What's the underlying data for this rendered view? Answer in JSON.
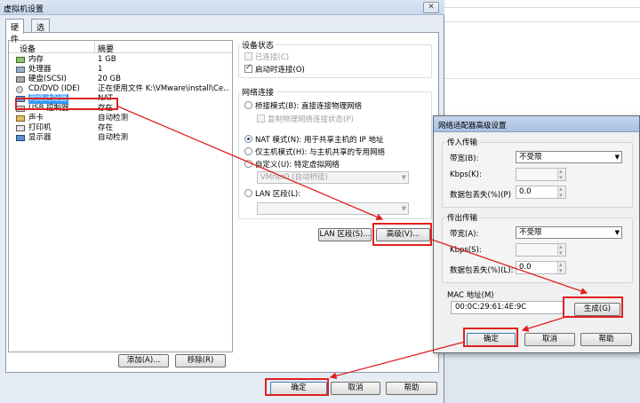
{
  "main_dialog": {
    "title": "虚拟机设置",
    "close": "✕",
    "tabs": [
      "硬件",
      "选项"
    ],
    "device_headers": {
      "device": "设备",
      "summary": "摘要"
    },
    "devices": [
      {
        "name": "内存",
        "summary": "1 GB",
        "icon": "memory-icon"
      },
      {
        "name": "处理器",
        "summary": "1",
        "icon": "cpu-icon"
      },
      {
        "name": "硬盘(SCSI)",
        "summary": "20 GB",
        "icon": "harddisk-icon"
      },
      {
        "name": "CD/DVD (IDE)",
        "summary": "正在使用文件 K:\\VMware\\install\\Ce...",
        "icon": "cdrom-icon"
      },
      {
        "name": "网络适配器",
        "summary": "NAT",
        "icon": "network-adapter-icon"
      },
      {
        "name": "USB 控制器",
        "summary": "存在",
        "icon": "usb-icon"
      },
      {
        "name": "声卡",
        "summary": "自动检测",
        "icon": "sound-icon"
      },
      {
        "name": "打印机",
        "summary": "存在",
        "icon": "printer-icon"
      },
      {
        "name": "显示器",
        "summary": "自动检测",
        "icon": "display-icon"
      }
    ],
    "add_button": "添加(A)...",
    "remove_button": "移除(R)",
    "device_status": {
      "label": "设备状态",
      "connected": "已连接(C)",
      "connect_on_poweron": "启动时连接(O)"
    },
    "network": {
      "label": "网络连接",
      "bridged": "桥接模式(B): 直接连接物理网络",
      "replicate": "复制物理网络连接状态(P)",
      "nat": "NAT 模式(N): 用于共享主机的 IP 地址",
      "hostonly": "仅主机模式(H): 与主机共享的专用网络",
      "custom": "自定义(U): 特定虚拟网络",
      "custom_value": "VMnet0 (自动桥接)",
      "lan": "LAN 区段(L):",
      "lan_value": ""
    },
    "lan_segments_button": "LAN 区段(S)...",
    "advanced_button": "高级(V)...",
    "ok": "确定",
    "cancel": "取消",
    "help": "帮助"
  },
  "advanced_dialog": {
    "title": "网络适配器高级设置",
    "incoming": {
      "label": "传入传输",
      "bandwidth_label": "带宽(B):",
      "bandwidth_value": "不受限",
      "kbps_label": "Kbps(K):",
      "kbps_value": "",
      "loss_label": "数据包丢失(%)(P)",
      "loss_value": "0.0"
    },
    "outgoing": {
      "label": "传出传输",
      "bandwidth_label": "带宽(A):",
      "bandwidth_value": "不受限",
      "kbps_label": "Kbps(S):",
      "kbps_value": "",
      "loss_label": "数据包丢失(%)(L):",
      "loss_value": "0.0"
    },
    "mac_label": "MAC 地址(M)",
    "mac_value": "00:0C:29:61:4E:9C",
    "generate": "生成(G)",
    "ok": "确定",
    "cancel": "取消",
    "help": "帮助"
  },
  "annotation_color": "#e02020"
}
